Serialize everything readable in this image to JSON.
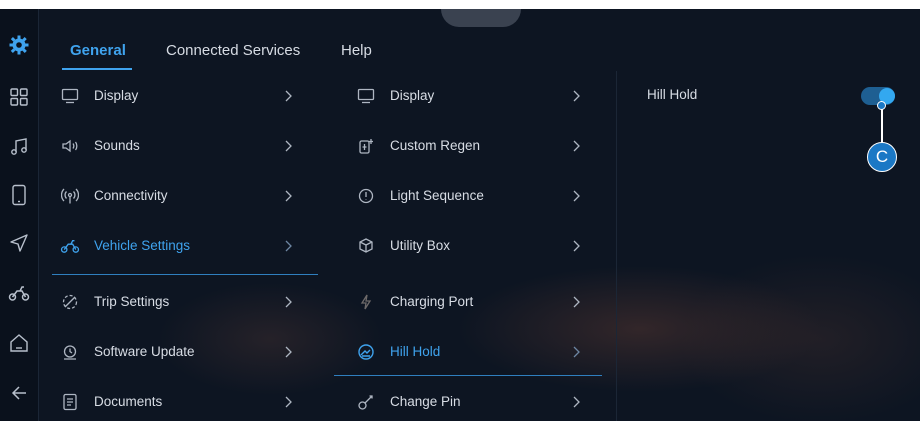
{
  "tabs": [
    {
      "label": "General",
      "active": true
    },
    {
      "label": "Connected Services",
      "active": false
    },
    {
      "label": "Help",
      "active": false
    }
  ],
  "sidebar": {
    "icons": [
      "settings-gear-icon",
      "apps-grid-icon",
      "music-icon",
      "phone-icon",
      "navigation-icon",
      "scooter-icon",
      "home-icon",
      "back-arrow-icon"
    ]
  },
  "menu": {
    "items": [
      {
        "label": "Display",
        "icon": "monitor-icon"
      },
      {
        "label": "Sounds",
        "icon": "speaker-icon"
      },
      {
        "label": "Connectivity",
        "icon": "signal-icon"
      },
      {
        "label": "Vehicle Settings",
        "icon": "scooter-icon",
        "active": true
      },
      {
        "label": "Trip Settings",
        "icon": "trip-icon"
      },
      {
        "label": "Software Update",
        "icon": "update-icon"
      },
      {
        "label": "Documents",
        "icon": "document-icon"
      }
    ]
  },
  "submenu": {
    "items": [
      {
        "label": "Display",
        "icon": "monitor-icon"
      },
      {
        "label": "Custom Regen",
        "icon": "regen-icon"
      },
      {
        "label": "Light Sequence",
        "icon": "light-icon"
      },
      {
        "label": "Utility Box",
        "icon": "box-icon"
      },
      {
        "label": "Charging Port",
        "icon": "charging-icon"
      },
      {
        "label": "Hill Hold",
        "icon": "hill-hold-icon",
        "active": true
      },
      {
        "label": "Change Pin",
        "icon": "key-icon"
      }
    ]
  },
  "detail": {
    "hill_hold_label": "Hill Hold",
    "hill_hold_enabled": true,
    "callout_letter": "C"
  },
  "colors": {
    "accent": "#3fa3ee",
    "background": "#0d1522",
    "callout": "#1b78c5"
  }
}
